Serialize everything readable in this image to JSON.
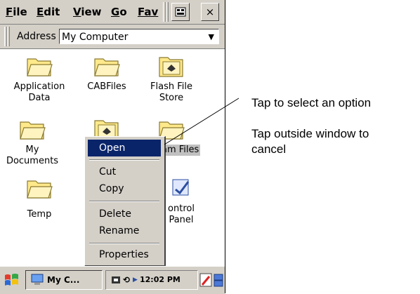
{
  "menubar": {
    "items": [
      {
        "underline": "F",
        "rest": "ile"
      },
      {
        "underline": "E",
        "rest": "dit"
      },
      {
        "underline": "V",
        "rest": "iew"
      },
      {
        "underline": "G",
        "rest": "o"
      },
      {
        "underline": "",
        "rest": "Fav"
      }
    ],
    "close_label": "×"
  },
  "address": {
    "label": "Address",
    "value": "My Computer",
    "dropdown_glyph": "▼"
  },
  "files": [
    {
      "label": "Application Data",
      "icon": "folder-icon"
    },
    {
      "label": "CABFiles",
      "icon": "folder-icon"
    },
    {
      "label": "Flash File Store",
      "icon": "storage-card-folder-icon"
    },
    {
      "label": "My Documents",
      "icon": "folder-icon"
    },
    {
      "label": "",
      "icon": "storage-card-folder-icon"
    },
    {
      "label": "ram Files",
      "icon": "folder-icon"
    },
    {
      "label": "Temp",
      "icon": "folder-icon"
    },
    {
      "label": "ontrol Panel",
      "icon": "control-panel-icon"
    }
  ],
  "context_menu": {
    "items": [
      "Open",
      "Cut",
      "Copy",
      "Delete",
      "Rename",
      "Properties"
    ],
    "highlighted": "Open"
  },
  "taskbar": {
    "task_label": "My C...",
    "clock": "12:02 PM"
  },
  "annotations": {
    "line1": "Tap to select an option",
    "line2a": "Tap outside window to",
    "line2b": "cancel"
  },
  "colors": {
    "chrome": "#d4d0c8",
    "highlight": "#0a246a",
    "folder": "#ffe98a"
  }
}
